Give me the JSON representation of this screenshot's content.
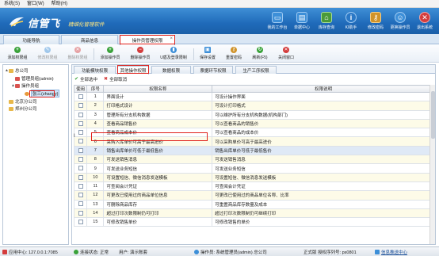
{
  "menu": [
    "系统(S)",
    "窗口(W)",
    "帮助(H)"
  ],
  "brand": {
    "name": "信管飞",
    "slogan": "精细化管理软件",
    "color": "#1f6ab9"
  },
  "top_buttons": [
    {
      "label": "我的工作台",
      "icon": "monitor-icon",
      "color": "#3d8fd8"
    },
    {
      "label": "单据中心",
      "icon": "documents-icon",
      "color": "#3d8fd8"
    },
    {
      "label": "库存查询",
      "icon": "warehouse-icon",
      "color": "#4a9a3a"
    },
    {
      "label": "KI助手",
      "icon": "info-icon",
      "color": "#2a78c6"
    },
    {
      "label": "修改密码",
      "icon": "key-icon",
      "color": "#d0932a"
    },
    {
      "label": "更换操作员",
      "icon": "user-icon",
      "color": "#3d8fd8"
    },
    {
      "label": "退出系统",
      "icon": "exit-icon",
      "color": "#d43c3c"
    }
  ],
  "tabs": [
    {
      "label": "功能导航"
    },
    {
      "label": "商品信息"
    },
    {
      "label": "操作员管理权限",
      "active": true
    }
  ],
  "toolbar": [
    {
      "label": "添加权限组",
      "icon": "add-icon",
      "color": "#3aa23a",
      "disabled": false
    },
    {
      "label": "修改权限组",
      "icon": "edit-icon",
      "color": "#3d8fd8",
      "disabled": true
    },
    {
      "label": "删除权限组",
      "icon": "delete-icon",
      "color": "#d43c3c",
      "disabled": true
    },
    {
      "label": "添加操作员",
      "icon": "add-user-icon",
      "color": "#3aa23a",
      "disabled": false
    },
    {
      "label": "删除操作员",
      "icon": "remove-user-icon",
      "color": "#d43c3c",
      "disabled": false
    },
    {
      "label": "U盾及登录限制",
      "icon": "usb-key-icon",
      "color": "#3d8fd8",
      "disabled": false
    },
    {
      "label": "保存设置",
      "icon": "save-icon",
      "color": "#3d8fd8",
      "disabled": false
    },
    {
      "label": "重置密码",
      "icon": "reset-password-icon",
      "color": "#d0932a",
      "disabled": false
    },
    {
      "label": "刷新(F5)",
      "icon": "refresh-icon",
      "color": "#3aa23a",
      "disabled": false
    },
    {
      "label": "关闭窗口",
      "icon": "close-window-icon",
      "color": "#d43c3c",
      "disabled": false
    }
  ],
  "tree": [
    {
      "label": "总公司",
      "toggle": "▲",
      "level": 0
    },
    {
      "label": "管理员组(admin)",
      "toggle": "",
      "level": 1
    },
    {
      "label": "操作员组",
      "toggle": "▲",
      "level": 1
    },
    {
      "label": "张三(zhangy)",
      "toggle": "",
      "level": 2,
      "selected": true
    },
    {
      "label": "北京分公司",
      "toggle": "",
      "level": 0
    },
    {
      "label": "郑州分公司",
      "toggle": "",
      "level": 0
    }
  ],
  "subtabs": [
    {
      "label": "功能模块权限"
    },
    {
      "label": "其他操作权限",
      "active": true
    },
    {
      "label": "数据权限"
    },
    {
      "label": "票据环节权限"
    },
    {
      "label": "生产工序权限"
    }
  ],
  "check_all": "全部选中",
  "uncheck_all": "全部取消",
  "columns": [
    "使用",
    "序号",
    "权限名称",
    "权限说明"
  ],
  "rows": [
    {
      "no": "1",
      "name": "界面设计",
      "desc": "可设计操作界面"
    },
    {
      "no": "2",
      "name": "打印格式设计",
      "desc": "可设计打印格式"
    },
    {
      "no": "3",
      "name": "管理所有分支机构数据",
      "desc": "可以维护所有分支机构数据(机构部门)"
    },
    {
      "no": "4",
      "name": "查看商品销售价",
      "desc": "可以查看商品的销售价"
    },
    {
      "no": "5",
      "name": "查看商品成本价",
      "desc": "可以查看商品的成本价"
    },
    {
      "no": "6",
      "name": "采购入库单价可高于最高进价",
      "desc": "可以采购单价可高于最高进价"
    },
    {
      "no": "7",
      "name": "销售出库单价可低于最低售价",
      "desc": "销售出库单价可低于最低售价"
    },
    {
      "no": "8",
      "name": "可发送销售消息",
      "desc": "可发送销售消息"
    },
    {
      "no": "9",
      "name": "可发送业务短信",
      "desc": "可发送业务短信"
    },
    {
      "no": "10",
      "name": "可设置短信、微信消息发送模板",
      "desc": "可设置短信、微信消息发送模板"
    },
    {
      "no": "11",
      "name": "可查阅会计凭证",
      "desc": "可查阅会计凭证"
    },
    {
      "no": "12",
      "name": "可更改已使用过的商品单位信息",
      "desc": "可更改已使用过的商品单位名称、比率"
    },
    {
      "no": "13",
      "name": "可删除商品库存",
      "desc": "可重置商品库存数量及成本"
    },
    {
      "no": "14",
      "name": "超过打印次数限制仍可打印",
      "desc": "超过打印次数限制仍可继续打印"
    },
    {
      "no": "15",
      "name": "可修改销售单价",
      "desc": "可修改销售的单价"
    }
  ],
  "status": {
    "server": "应用中心: 127.0.0.1:7085",
    "connection": "连接状态: 正常",
    "user": "用户: 演示账套",
    "operator": "操作员: 系统管理员(admin) 总公司",
    "version": "正式版 授权序列号: ps0801",
    "link": "信息推送中心"
  }
}
